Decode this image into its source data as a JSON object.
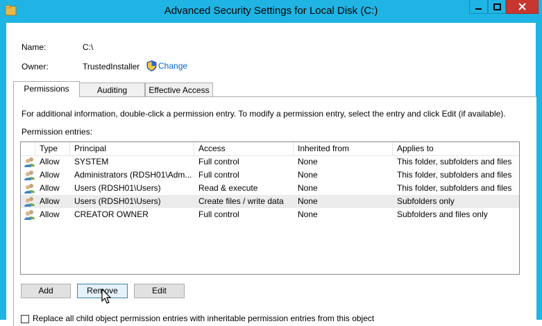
{
  "window": {
    "title": "Advanced Security Settings for Local Disk (C:)",
    "titlebar_color": "#1fb4e4"
  },
  "info": {
    "name_label": "Name:",
    "name_value": "C:\\",
    "owner_label": "Owner:",
    "owner_value": "TrustedInstaller",
    "change_link": "Change"
  },
  "tabs": [
    {
      "label": "Permissions",
      "active": true
    },
    {
      "label": "Auditing",
      "active": false
    },
    {
      "label": "Effective Access",
      "active": false
    }
  ],
  "permissions": {
    "instructions": "For additional information, double-click a permission entry. To modify a permission entry, select the entry and click Edit (if available).",
    "entries_label": "Permission entries:",
    "columns": [
      "Type",
      "Principal",
      "Access",
      "Inherited from",
      "Applies to"
    ],
    "rows": [
      {
        "type": "Allow",
        "principal": "SYSTEM",
        "access": "Full control",
        "inherited": "None",
        "applies": "This folder, subfolders and files"
      },
      {
        "type": "Allow",
        "principal": "Administrators (RDSH01\\Adm...",
        "access": "Full control",
        "inherited": "None",
        "applies": "This folder, subfolders and files"
      },
      {
        "type": "Allow",
        "principal": "Users (RDSH01\\Users)",
        "access": "Read & execute",
        "inherited": "None",
        "applies": "This folder, subfolders and files"
      },
      {
        "type": "Allow",
        "principal": "Users (RDSH01\\Users)",
        "access": "Create files / write data",
        "inherited": "None",
        "applies": "Subfolders only"
      },
      {
        "type": "Allow",
        "principal": "CREATOR OWNER",
        "access": "Full control",
        "inherited": "None",
        "applies": "Subfolders and files only"
      }
    ],
    "selected_row_index": 3
  },
  "buttons": {
    "add": "Add",
    "remove": "Remove",
    "edit": "Edit"
  },
  "checkbox": {
    "label": "Replace all child object permission entries with inheritable permission entries from this object",
    "checked": false
  },
  "icons": {
    "folder": "folder-icon",
    "shield": "uac-shield-icon",
    "users": "users-icon",
    "cursor": "mouse-pointer-icon"
  }
}
